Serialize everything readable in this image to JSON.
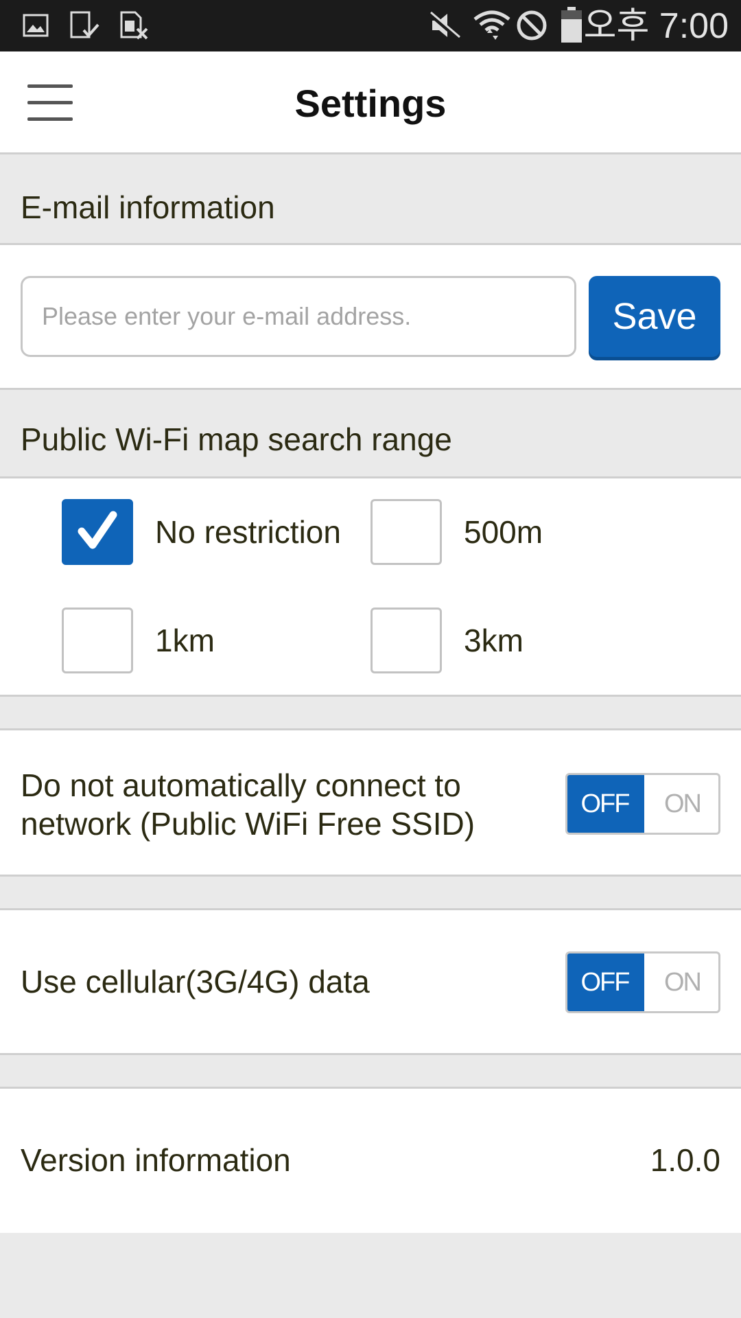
{
  "status_bar": {
    "time": "오후 7:00",
    "left_icons": [
      "image-icon",
      "download-done-icon",
      "sim-error-icon"
    ],
    "right_icons": [
      "mute-icon",
      "wifi-icon",
      "blocked-icon",
      "battery-icon"
    ]
  },
  "header": {
    "title": "Settings",
    "menu_icon": "hamburger-menu-icon"
  },
  "email_section": {
    "title": "E-mail information",
    "input_placeholder": "Please enter your e-mail address.",
    "input_value": "",
    "save_label": "Save"
  },
  "range_section": {
    "title": "Public Wi-Fi map search range",
    "options": [
      {
        "label": "No restriction",
        "checked": true
      },
      {
        "label": "500m",
        "checked": false
      },
      {
        "label": "1km",
        "checked": false
      },
      {
        "label": "3km",
        "checked": false
      }
    ]
  },
  "auto_connect": {
    "label_line1": "Do not automatically connect to",
    "label_line2": "network (Public WiFi Free SSID)",
    "off_label": "OFF",
    "on_label": "ON",
    "state": "OFF"
  },
  "cellular": {
    "label": "Use cellular(3G/4G) data",
    "off_label": "OFF",
    "on_label": "ON",
    "state": "OFF"
  },
  "version": {
    "label": "Version information",
    "value": "1.0.0"
  },
  "colors": {
    "accent": "#0f64b8",
    "background": "#eaeaea",
    "text": "#2b2a12"
  }
}
